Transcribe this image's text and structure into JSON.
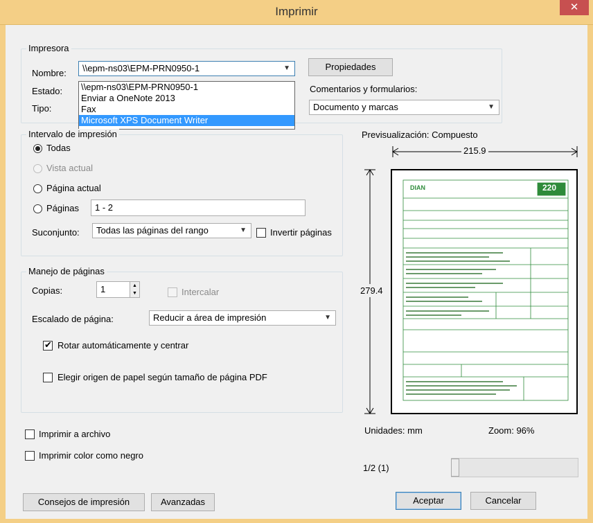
{
  "window": {
    "title": "Imprimir",
    "close_glyph": "✕"
  },
  "printer": {
    "group_label": "Impresora",
    "name_label": "Nombre:",
    "name_value": "\\\\epm-ns03\\EPM-PRN0950-1",
    "status_label": "Estado:",
    "type_label": "Tipo:",
    "properties_button": "Propiedades",
    "comments_label": "Comentarios y formularios:",
    "comments_value": "Documento y marcas",
    "dropdown_options": [
      "\\\\epm-ns03\\EPM-PRN0950-1",
      "Enviar a OneNote 2013",
      "Fax",
      "Microsoft XPS Document Writer"
    ]
  },
  "range": {
    "group_label": "Intervalo de impresión",
    "all": "Todas",
    "current_view": "Vista actual",
    "current_page": "Página actual",
    "pages": "Páginas",
    "pages_value": "1 - 2",
    "subset_label": "Suconjunto:",
    "subset_value": "Todas las páginas del rango",
    "reverse_pages": "Invertir páginas"
  },
  "handling": {
    "group_label": "Manejo de páginas",
    "copies_label": "Copias:",
    "copies_value": "1",
    "collate": "Intercalar",
    "scaling_label": "Escalado de página:",
    "scaling_value": "Reducir a área de impresión",
    "auto_rotate": "Rotar automáticamente y centrar",
    "paper_source": "Elegir origen de papel según tamaño de página PDF"
  },
  "options": {
    "print_to_file": "Imprimir a archivo",
    "print_black": "Imprimir color como negro"
  },
  "preview": {
    "label": "Previsualización: Compuesto",
    "width_value": "215.9",
    "height_value": "279.4",
    "units": "Unidades: mm",
    "zoom": "Zoom:  96%",
    "page_counter": "1/2 (1)",
    "form_number": "220",
    "form_logo": "DIAN"
  },
  "buttons": {
    "tips": "Consejos de impresión",
    "advanced": "Avanzadas",
    "accept": "Aceptar",
    "cancel": "Cancelar"
  },
  "colors": {
    "title_bar": "#f4cf86",
    "close": "#c75050",
    "selection": "#3399ff",
    "form_green": "#2e8b3a"
  },
  "icons": {
    "close": "close-icon",
    "dropdown": "chevron-down-icon",
    "spin_up": "spin-up-icon",
    "spin_down": "spin-down-icon"
  }
}
